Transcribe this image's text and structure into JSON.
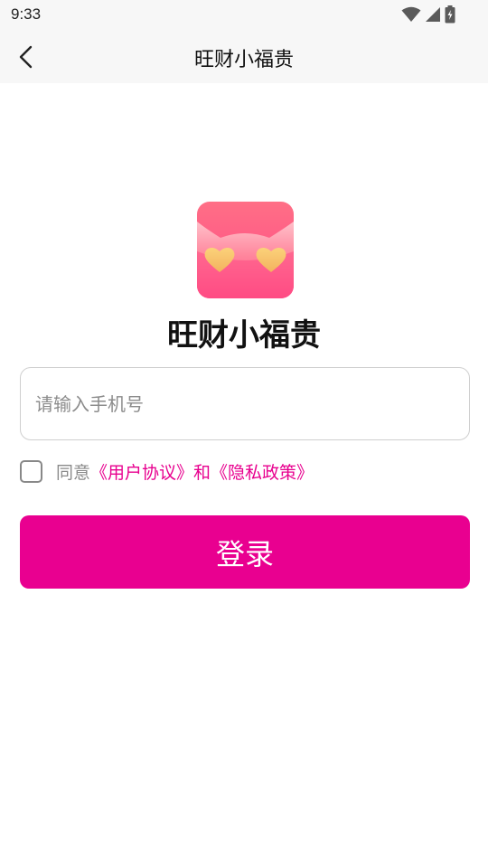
{
  "status_bar": {
    "time": "9:33"
  },
  "nav": {
    "title": "旺财小福贵"
  },
  "app": {
    "name": "旺财小福贵"
  },
  "login_form": {
    "phone_placeholder": "请输入手机号",
    "phone_value": "",
    "agree_checked": false,
    "agree_prefix": "同意",
    "user_agreement_link": "《用户协议》",
    "and_text": "和",
    "privacy_policy_link": "《隐私政策》",
    "login_label": "登录"
  },
  "colors": {
    "accent": "#e90090",
    "link": "#e8008f",
    "icon_gradient_top": "#ff7a8e",
    "icon_gradient_bottom": "#ff4d85",
    "heart": "#f7c66e"
  },
  "icons": [
    "wifi-icon",
    "cell-signal-icon",
    "battery-icon",
    "back-arrow-icon",
    "app-logo-icon",
    "heart-icon"
  ]
}
